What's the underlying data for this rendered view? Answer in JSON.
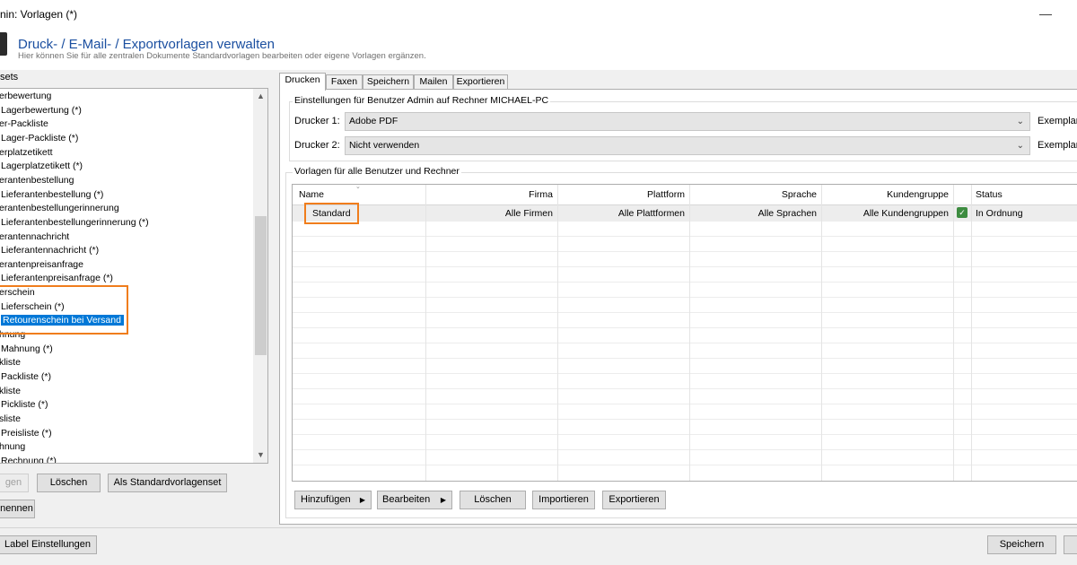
{
  "window": {
    "title": "nin: Vorlagen (*)",
    "minimize_glyph": "—"
  },
  "header": {
    "title": "Druck- / E-Mail- / Exportvorlagen verwalten",
    "subtitle": "Hier können Sie für alle zentralen Dokumente Standardvorlagen bearbeiten oder eigene Vorlagen ergänzen."
  },
  "left": {
    "label": "sets",
    "tree": [
      {
        "label": "erbewertung",
        "selected": false
      },
      {
        "label": "Lagerbewertung (*)",
        "selected": false
      },
      {
        "label": "er-Packliste",
        "selected": false
      },
      {
        "label": "Lager-Packliste (*)",
        "selected": false
      },
      {
        "label": "erplatzetikett",
        "selected": false
      },
      {
        "label": "Lagerplatzetikett (*)",
        "selected": false
      },
      {
        "label": "erantenbestellung",
        "selected": false
      },
      {
        "label": "Lieferantenbestellung (*)",
        "selected": false
      },
      {
        "label": "erantenbestellungerinnerung",
        "selected": false
      },
      {
        "label": "Lieferantenbestellungerinnerung (*)",
        "selected": false
      },
      {
        "label": "erantennachricht",
        "selected": false
      },
      {
        "label": "Lieferantennachricht (*)",
        "selected": false
      },
      {
        "label": "erantenpreisanfrage",
        "selected": false
      },
      {
        "label": "Lieferantenpreisanfrage (*)",
        "selected": false
      },
      {
        "label": "erschein",
        "selected": false
      },
      {
        "label": "Lieferschein (*)",
        "selected": false
      },
      {
        "label": "Retourenschein bei Versand",
        "selected": true
      },
      {
        "label": "hnung",
        "selected": false
      },
      {
        "label": "Mahnung (*)",
        "selected": false
      },
      {
        "label": "kliste",
        "selected": false
      },
      {
        "label": "Packliste (*)",
        "selected": false
      },
      {
        "label": "kliste",
        "selected": false
      },
      {
        "label": "Pickliste (*)",
        "selected": false
      },
      {
        "label": "sliste",
        "selected": false
      },
      {
        "label": "Preisliste (*)",
        "selected": false
      },
      {
        "label": "hnung",
        "selected": false
      },
      {
        "label": "Rechnung (*)",
        "selected": false
      }
    ],
    "buttons": {
      "add": "gen",
      "delete": "Löschen",
      "as_default": "Als Standardvorlagenset",
      "rename": "nennen"
    }
  },
  "tabs": [
    "Drucken",
    "Faxen",
    "Speichern",
    "Mailen",
    "Exportieren"
  ],
  "active_tab": "Drucken",
  "printer_settings": {
    "group_title": "Einstellungen für Benutzer Admin auf Rechner MICHAEL-PC",
    "printer1_label": "Drucker 1:",
    "printer1_value": "Adobe PDF",
    "printer2_label": "Drucker 2:",
    "printer2_value": "Nicht verwenden",
    "copies_label_1": "Exemplar",
    "copies_label_2": "Exemplar"
  },
  "templates": {
    "group_title": "Vorlagen für alle Benutzer und Rechner",
    "columns": [
      "Name",
      "Firma",
      "Plattform",
      "Sprache",
      "Kundengruppe",
      "",
      "Status"
    ],
    "rows": [
      {
        "name": "Standard",
        "firma": "Alle Firmen",
        "plattform": "Alle Plattformen",
        "sprache": "Alle Sprachen",
        "kundengruppe": "Alle Kundengruppen",
        "status_icon": "check-icon",
        "status": "In Ordnung"
      }
    ],
    "buttons": {
      "add": "Hinzufügen",
      "edit": "Bearbeiten",
      "delete": "Löschen",
      "import": "Importieren",
      "export": "Exportieren"
    }
  },
  "footer": {
    "label_settings": "Label Einstellungen",
    "save": "Speichern"
  },
  "colors": {
    "title_blue": "#1b4fa0",
    "selection": "#0078d7",
    "highlight_orange": "#f07d1c",
    "status_green": "#3d8c40"
  }
}
